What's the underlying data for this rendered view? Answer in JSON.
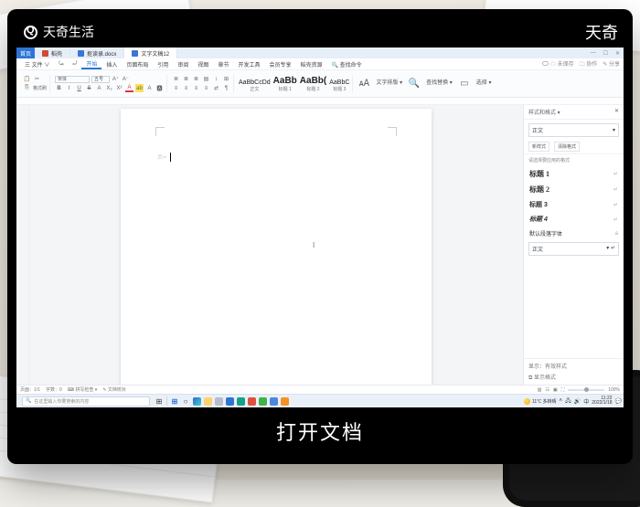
{
  "watermark": {
    "left": "天奇生活",
    "right": "天奇"
  },
  "caption": "打开文档",
  "tabstrip": {
    "start": "首页",
    "tabs": [
      {
        "icon": "di-red",
        "label": "稻壳"
      },
      {
        "icon": "di-blue",
        "label": "抠读录.docx"
      },
      {
        "icon": "di-blue",
        "label": "文字文稿12"
      }
    ],
    "wincontrols": [
      "—",
      "☐",
      "✕"
    ]
  },
  "menu": {
    "items": [
      "三 文件 ∨",
      "⤿",
      "⤾",
      "开始",
      "插入",
      "页面布局",
      "引用",
      "审阅",
      "视图",
      "章节",
      "开发工具",
      "会员专享",
      "稻壳资源"
    ],
    "activeIndex": 3,
    "search": "🔍 查找命令",
    "right": [
      "☁ 未保存",
      "🗀 协作",
      "✎ 分享"
    ]
  },
  "ribbon": {
    "font": "宋体",
    "size": "五号",
    "formatIcons1": [
      "📋",
      "✂",
      "⎘",
      "格式刷"
    ],
    "formatIcons2": [
      "B",
      "I",
      "U",
      "S",
      "A",
      "X₂",
      "X²",
      "A",
      "ab",
      "A",
      "🅰"
    ],
    "paraIcons1": [
      "≣",
      "≣",
      "≣",
      "▤",
      "↕",
      "|",
      "⊞"
    ],
    "paraIcons2": [
      "≡",
      "≡",
      "≡",
      "≡",
      "⇄",
      "|",
      "¶"
    ],
    "styles": [
      {
        "name": "正文",
        "preview": "AaBbCcDd"
      },
      {
        "name": "标题 1",
        "preview": "AaBb"
      },
      {
        "name": "标题 2",
        "preview": "AaBb("
      },
      {
        "name": "标题 3",
        "preview": "AaBbC"
      }
    ],
    "actions": [
      "文字排版 ▾",
      "查找替换 ▾",
      "选择 ▾"
    ]
  },
  "page": {
    "headerGhost": "页↵",
    "ibeam": "I"
  },
  "sidepanel": {
    "title": "样式和格式 ▾",
    "close": "✕",
    "current": "正文",
    "miniActions": [
      "新样式",
      "清除格式"
    ],
    "listLabel": "请选择要应用的格式",
    "items": [
      {
        "cls": "h1",
        "name": "标题 1"
      },
      {
        "cls": "h2",
        "name": "标题 2"
      },
      {
        "cls": "h3",
        "name": "标题 3"
      },
      {
        "cls": "h4",
        "name": "标题 4"
      },
      {
        "cls": "txt",
        "name": "默认段落字体"
      }
    ],
    "selection": "正文",
    "showLabel": "显示：有效样式",
    "bottomLabel": "⧉ 显示格式"
  },
  "statusbar": {
    "left": [
      "页面：1/1",
      "字数：0",
      "⌨ 拼写检查 ▾",
      "✎ 文档校对"
    ],
    "right": [
      "▥",
      "☷",
      "▣",
      "⛶"
    ],
    "zoom": "100%"
  },
  "taskbar": {
    "searchPlaceholder": "在这里输入你要搜索的内容",
    "weather": "11℃  多转晴",
    "time1": "11:22",
    "time2": "2022/1/18"
  }
}
